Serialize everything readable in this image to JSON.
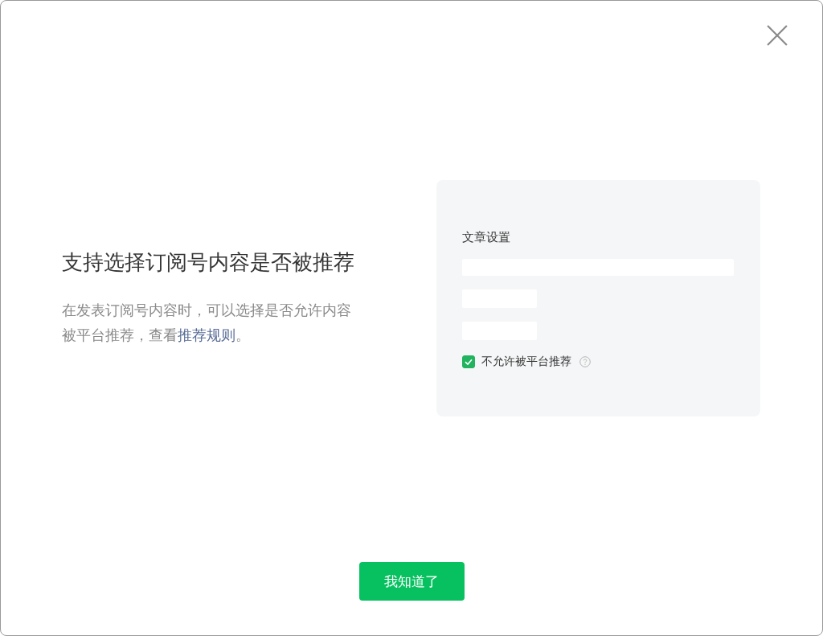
{
  "dialog": {
    "title": "支持选择订阅号内容是否被推荐",
    "description": [
      {
        "kind": "text",
        "text": "在发表订阅号内容时，可以选择是否允许内容被平台推荐，查看"
      },
      {
        "kind": "link",
        "text": "推荐规则"
      },
      {
        "kind": "text",
        "text": "。"
      }
    ],
    "preview_card": {
      "title": "文章设置",
      "blank_rows": [
        {
          "kind": "wide"
        },
        {
          "kind": "short"
        },
        {
          "kind": "short"
        }
      ],
      "checkbox": {
        "label": "不允许被平台推荐",
        "checked": true
      }
    },
    "confirm_button": "我知道了"
  }
}
